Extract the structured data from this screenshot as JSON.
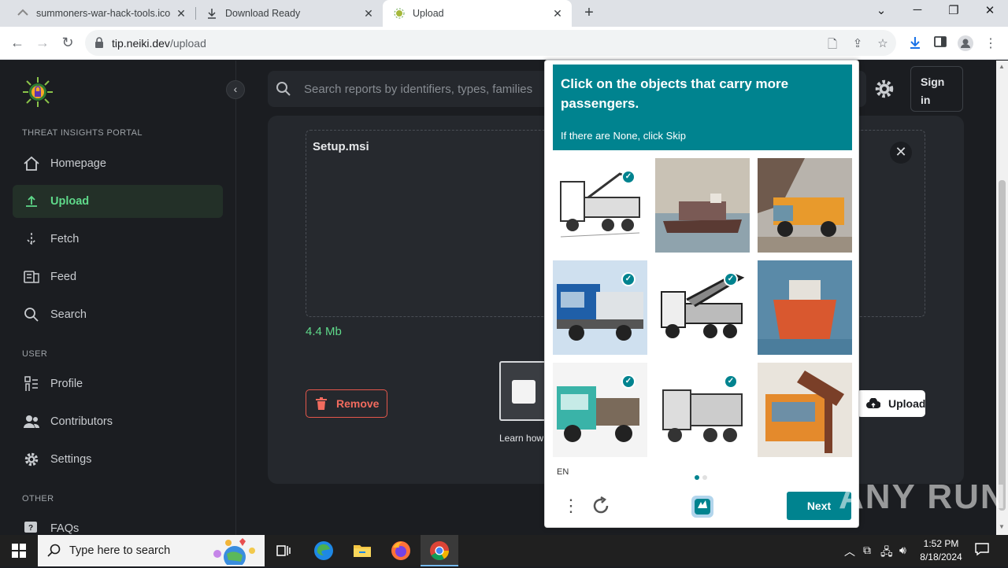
{
  "browser": {
    "tabs": [
      {
        "title": "summoners-war-hack-tools.ico",
        "active": false
      },
      {
        "title": "Download Ready",
        "active": false
      },
      {
        "title": "Upload",
        "active": true
      }
    ],
    "new_tab": "+",
    "url_host": "tip.neiki.dev",
    "url_path": "/upload"
  },
  "sidebar": {
    "section_portal": "THREAT INSIGHTS PORTAL",
    "section_user": "USER",
    "section_other": "OTHER",
    "items": [
      {
        "label": "Homepage",
        "icon": "home-icon"
      },
      {
        "label": "Upload",
        "icon": "upload-icon",
        "active": true
      },
      {
        "label": "Fetch",
        "icon": "fetch-icon"
      },
      {
        "label": "Feed",
        "icon": "feed-icon"
      },
      {
        "label": "Search",
        "icon": "search-icon"
      },
      {
        "label": "Profile",
        "icon": "profile-icon"
      },
      {
        "label": "Contributors",
        "icon": "contributors-icon"
      },
      {
        "label": "Settings",
        "icon": "settings-icon"
      },
      {
        "label": "FAQs",
        "icon": "faq-icon"
      }
    ]
  },
  "header": {
    "search_placeholder": "Search reports by identifiers, types, families",
    "signin_line1": "Sign",
    "signin_line2": "in"
  },
  "upload": {
    "filename": "Setup.msi",
    "filesize": "4.4 Mb",
    "remove_label": "Remove",
    "upload_label": "Upload",
    "learn_label": "Learn how"
  },
  "captcha": {
    "title": "Click on the objects that carry more passengers.",
    "subtitle": "If there are None, click Skip",
    "language": "EN",
    "next_label": "Next",
    "accent": "#00838f",
    "images": [
      {
        "subject": "sketch-truck-crane",
        "selected": true
      },
      {
        "subject": "cargo-ship",
        "selected": false
      },
      {
        "subject": "orange-dump-truck",
        "selected": false
      },
      {
        "subject": "blue-semi-truck",
        "selected": true
      },
      {
        "subject": "sketch-crane-truck",
        "selected": true
      },
      {
        "subject": "orange-ship",
        "selected": false
      },
      {
        "subject": "teal-logging-truck",
        "selected": true
      },
      {
        "subject": "sketch-dump-truck",
        "selected": true
      },
      {
        "subject": "orange-truck-hammer",
        "selected": false
      }
    ]
  },
  "watermark": "ANY RUN",
  "taskbar": {
    "search_placeholder": "Type here to search",
    "time": "1:52 PM",
    "date": "8/18/2024"
  },
  "colors": {
    "brand_green": "#5fd98a",
    "danger": "#e4574b",
    "captcha_teal": "#00838f"
  }
}
